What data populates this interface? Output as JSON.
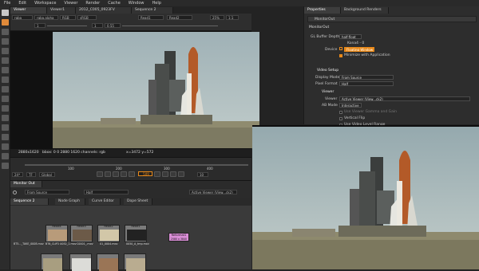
{
  "menu": [
    "File",
    "Edit",
    "Workspace",
    "Viewer",
    "Render",
    "Cache",
    "Window",
    "Help"
  ],
  "viewer_tabs": [
    "Viewer",
    "Viewer1",
    "2012_C005_0923FV",
    "Sequence 2"
  ],
  "viewer_controls": {
    "channels": "rgba",
    "alpha": "rgba.alpha",
    "cs": "RGB",
    "lut": "sRGB",
    "a_input": "Read1",
    "b_input": "Read2",
    "gain": "1",
    "gamma": "1",
    "zoom": "25%",
    "ratio": "1:1",
    "value": "0.55"
  },
  "info_bar": {
    "res": "2880x1620",
    "bbox": "bbox: 0 0 2880 1620 channels: rgb",
    "coords": "x=3472 y=572",
    "corner": "2880,1620"
  },
  "timeline": {
    "fps": "24*",
    "tc": "TF",
    "scope": "Global",
    "ticks": [
      "100",
      "200",
      "300",
      "400"
    ],
    "frame": "509",
    "end": "10"
  },
  "monitor_out": {
    "title": "Monitor Out",
    "source": "From Source",
    "mode": "Half",
    "viewer": "Active Viewer (View...ck2)"
  },
  "node_tabs": [
    "Sequence 2",
    "Node Graph",
    "Curve Editor",
    "Dope Sheet"
  ],
  "nodes": [
    {
      "label": "Read4",
      "sub": "BT6_CLIP2 0052_1.mov",
      "file": "BT5..._TAKE_0008.mov"
    },
    {
      "label": "Read3",
      "sub": "BT5_AS_0004.mov",
      "file": "C0001_.mov"
    },
    {
      "label": "Read2",
      "sub": "BT5_AS_0051_A.mov",
      "file": "01_0004.mov"
    },
    {
      "label": "Read1",
      "sub": "BT5_AS_0001_A.mov",
      "file": "0050_A_tmp.mov"
    },
    {
      "label": "Reformat1",
      "sub": "2580 x 3840"
    }
  ],
  "properties": {
    "tabs": [
      "Properties",
      "Background Renders"
    ],
    "node_name": "MonitorOut",
    "section": "MonitorOut",
    "gl_buffer_label": "GL Buffer Depth",
    "gl_buffer_value": "half-float",
    "kin_label": "Kona4 - 0",
    "device_label": "Device",
    "device_value": "Floating Window",
    "minimize_label": "Minimize with Application",
    "video_setup": "Video Setup",
    "display_mode_label": "Display Mode",
    "display_mode_value": "From Source",
    "pixel_format_label": "Pixel Format",
    "pixel_format_value": "Half",
    "viewer_section": "Viewer",
    "viewer_label": "Viewer",
    "viewer_value": "Active Viewer (View...ck2)",
    "ab_mode_label": "AB Mode",
    "ab_mode_value": "Interactive",
    "opt1": "Use Viewer Gamma and Gain",
    "opt2": "Vertical Flip",
    "opt3": "Use Video Level Range"
  },
  "colors": {
    "accent": "#e8891a",
    "node_pink": "#d98ed6"
  }
}
